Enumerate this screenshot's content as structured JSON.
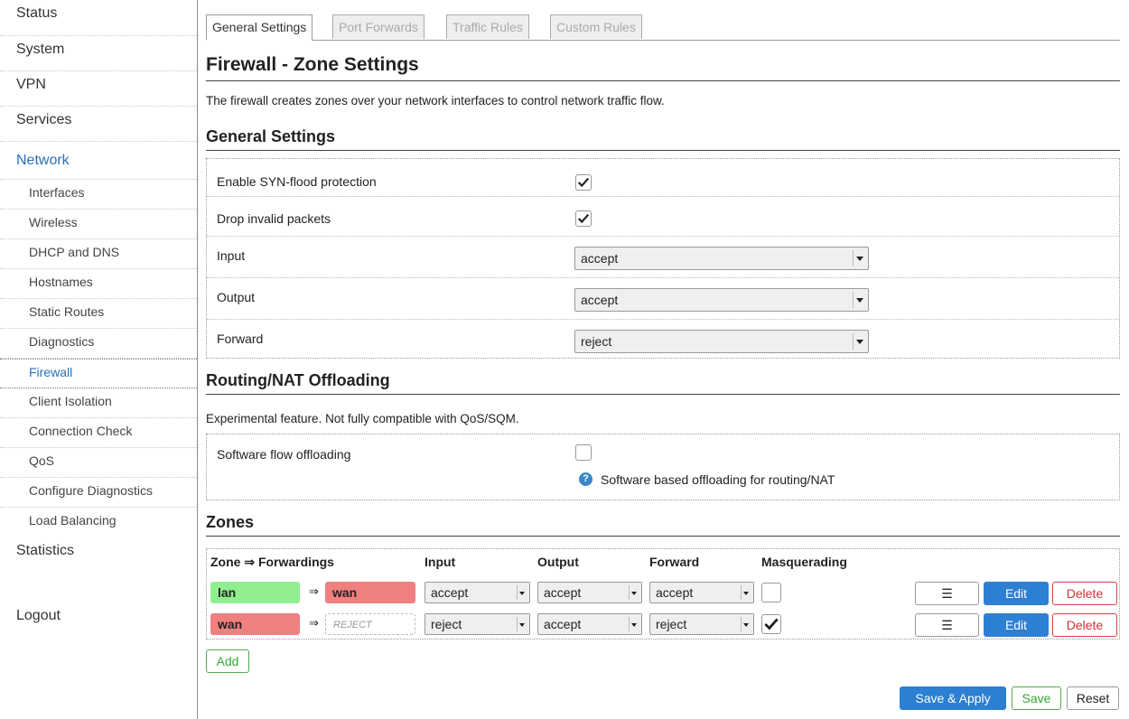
{
  "sidebar": {
    "top_items": [
      "Status",
      "System",
      "VPN",
      "Services",
      "Network"
    ],
    "network_subitems": [
      "Interfaces",
      "Wireless",
      "DHCP and DNS",
      "Hostnames",
      "Static Routes",
      "Diagnostics",
      "Firewall",
      "Client Isolation",
      "Connection Check",
      "QoS",
      "Configure Diagnostics",
      "Load Balancing"
    ],
    "statistics": "Statistics",
    "logout": "Logout"
  },
  "tabs": [
    "General Settings",
    "Port Forwards",
    "Traffic Rules",
    "Custom Rules"
  ],
  "page": {
    "title": "Firewall - Zone Settings",
    "description": "The firewall creates zones over your network interfaces to control network traffic flow."
  },
  "general": {
    "heading": "General Settings",
    "syn_flood_label": "Enable SYN-flood protection",
    "syn_flood_checked": true,
    "drop_invalid_label": "Drop invalid packets",
    "drop_invalid_checked": true,
    "input_label": "Input",
    "input_value": "accept",
    "output_label": "Output",
    "output_value": "accept",
    "forward_label": "Forward",
    "forward_value": "reject"
  },
  "offloading": {
    "heading": "Routing/NAT Offloading",
    "description": "Experimental feature. Not fully compatible with QoS/SQM.",
    "sw_flow_label": "Software flow offloading",
    "sw_flow_checked": false,
    "help_icon": "?",
    "help_text": "Software based offloading for routing/NAT"
  },
  "zones": {
    "heading": "Zones",
    "headers": {
      "zone": "Zone ⇒ Forwardings",
      "input": "Input",
      "output": "Output",
      "forward": "Forward",
      "masq": "Masquerading"
    },
    "arrow": "⇒",
    "rows": [
      {
        "zone": "lan",
        "forward_to": "wan",
        "input": "accept",
        "output": "accept",
        "forward": "accept",
        "masquerading": false
      },
      {
        "zone": "wan",
        "forward_to": "REJECT",
        "input": "reject",
        "output": "accept",
        "forward": "reject",
        "masquerading": true
      }
    ],
    "menu_glyph": "☰",
    "edit_label": "Edit",
    "delete_label": "Delete",
    "add_label": "Add"
  },
  "footer": {
    "save_apply": "Save & Apply",
    "save": "Save",
    "reset": "Reset"
  },
  "colors": {
    "accent": "#2c7fd3",
    "zone_lan": "#90ee90",
    "zone_wan": "#f08080",
    "delete": "#cc3333",
    "save": "#33aa33"
  }
}
